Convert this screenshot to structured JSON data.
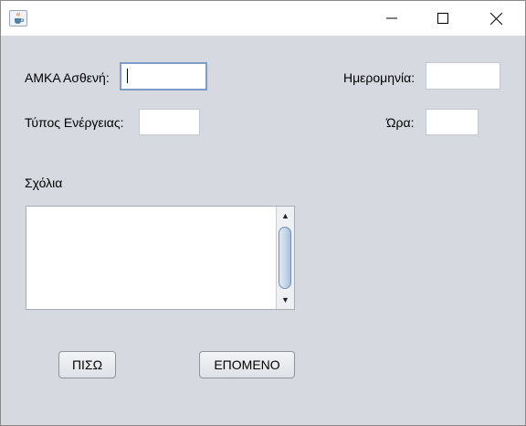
{
  "window": {
    "app_icon": "java-cup-icon",
    "controls": {
      "minimize": "minimize-icon",
      "maximize": "maximize-icon",
      "close": "close-icon"
    }
  },
  "form": {
    "amka_label": "ΑΜΚΑ Ασθενή:",
    "amka_value": "",
    "date_label": "Ημερομηνία:",
    "date_value": "",
    "type_label": "Τύπος Ενέργειας:",
    "type_value": "",
    "time_label": "Ώρα:",
    "time_value": "",
    "comments_label": "Σχόλια",
    "comments_value": ""
  },
  "buttons": {
    "back_label": "ΠΙΣΩ",
    "next_label": "ΕΠΟΜΕΝΟ"
  },
  "colors": {
    "background": "#d6d9df",
    "focus_border": "#7a9cc6"
  }
}
